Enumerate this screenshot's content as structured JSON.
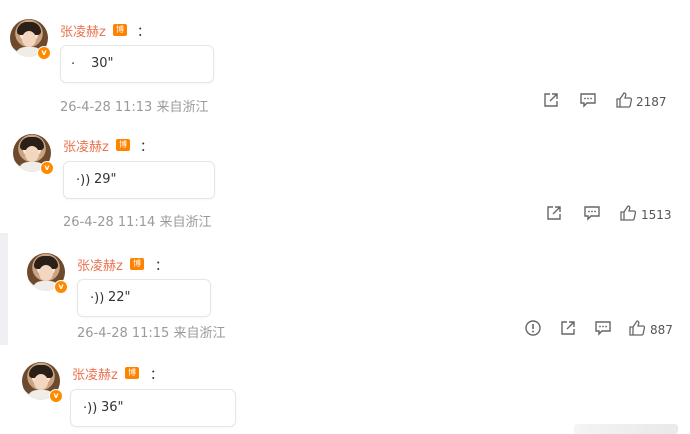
{
  "comments": [
    {
      "user": "张凌赫z",
      "badge": "博主",
      "colon": "：",
      "duration": "30\"",
      "wave": "·",
      "meta": "26-4-28 11:13 来自浙江",
      "likes": "2187"
    },
    {
      "user": "张凌赫z",
      "badge": "博主",
      "colon": "：",
      "duration": "29\"",
      "wave": "·))",
      "meta": "26-4-28 11:14 来自浙江",
      "likes": "1513"
    },
    {
      "user": "张凌赫z",
      "badge": "博主",
      "colon": "：",
      "duration": "22\"",
      "wave": "·))",
      "meta": "26-4-28 11:15 来自浙江",
      "likes": "887"
    },
    {
      "user": "张凌赫z",
      "badge": "博主",
      "colon": "：",
      "duration": "36\"",
      "wave": "·))",
      "meta": "",
      "likes": ""
    }
  ],
  "icons": {
    "verified": "verified-v-icon",
    "share": "share-icon",
    "comment": "comment-icon",
    "like": "thumbs-up-icon",
    "report": "report-icon"
  },
  "colors": {
    "username": "#eb7350",
    "badge": "#ff8200",
    "verified": "#ff8a00",
    "meta": "#9a9a9a"
  }
}
